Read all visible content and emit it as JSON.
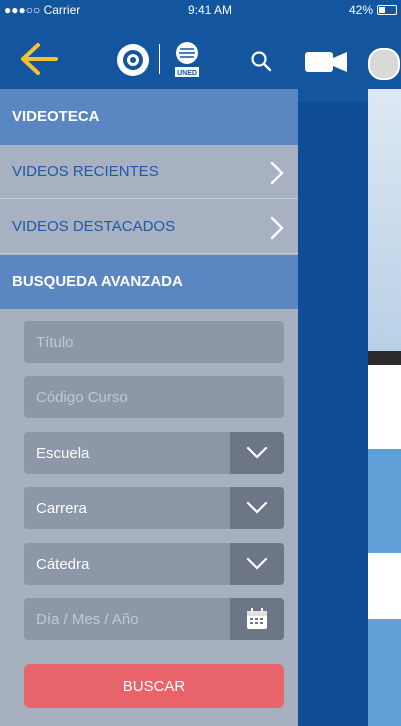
{
  "status_bar": {
    "carrier": "●●●○○ Carrier",
    "time": "9:41 AM",
    "battery": "42%"
  },
  "header": {
    "back_icon": "arrow-left-icon",
    "logos": [
      "logo-icon",
      "uned-logo-icon"
    ],
    "uned_text": "UNED",
    "search_icon": "search-icon",
    "camera_icon": "video-camera-icon",
    "avatar_icon": "user-avatar-icon"
  },
  "sidebar": {
    "section_videoteca": "VIDEOTECA",
    "items": [
      {
        "label": "VIDEOS RECIENTES"
      },
      {
        "label": "VIDEOS DESTACADOS"
      }
    ],
    "section_busqueda": "BUSQUEDA AVANZADA",
    "fields": {
      "titulo": {
        "placeholder": "Título"
      },
      "codigo": {
        "placeholder": "Código Curso"
      },
      "escuela": {
        "value": "Escuela"
      },
      "carrera": {
        "value": "Carrera"
      },
      "catedra": {
        "value": "Cátedra"
      },
      "fecha": {
        "placeholder": "Día / Mes / Año"
      }
    },
    "submit_label": "BUSCAR"
  },
  "colors": {
    "header_blue": "#13559e",
    "section_blue": "#5a87c2",
    "link_blue": "#1e5aa5",
    "buscar_red": "#e8646a"
  }
}
